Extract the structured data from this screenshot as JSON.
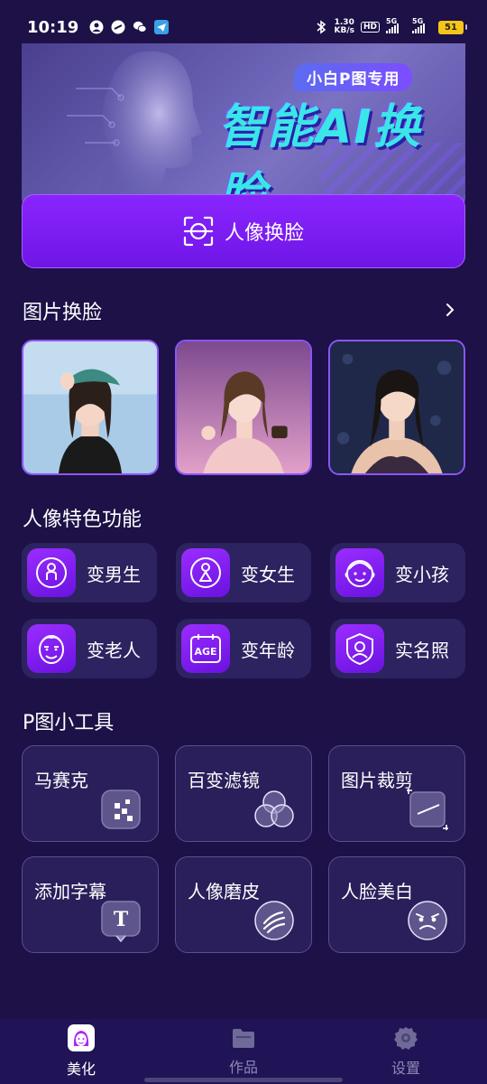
{
  "status_bar": {
    "time": "10:19",
    "net_speed_value": "1.30",
    "net_speed_unit": "KB/s",
    "hd": "HD",
    "sig1": "5G",
    "sig2": "5G",
    "battery": "51"
  },
  "banner": {
    "tag": "小白P图专用",
    "title": "智能AI换脸"
  },
  "face_swap_button": {
    "label": "人像换脸",
    "icon": "face-scan-icon"
  },
  "photo_section": {
    "title": "图片换脸"
  },
  "features_section": {
    "title": "人像特色功能",
    "items": [
      {
        "label": "变男生",
        "icon": "male-icon"
      },
      {
        "label": "变女生",
        "icon": "female-icon"
      },
      {
        "label": "变小孩",
        "icon": "child-face-icon"
      },
      {
        "label": "变老人",
        "icon": "elder-face-icon"
      },
      {
        "label": "变年龄",
        "icon": "age-icon"
      },
      {
        "label": "实名照",
        "icon": "id-photo-icon"
      }
    ],
    "age_icon_text": "AGE"
  },
  "tools_section": {
    "title": "P图小工具",
    "items": [
      {
        "label": "马赛克",
        "icon": "mosaic-icon"
      },
      {
        "label": "百变滤镜",
        "icon": "filter-icon"
      },
      {
        "label": "图片裁剪",
        "icon": "crop-icon"
      },
      {
        "label": "添加字幕",
        "icon": "text-icon"
      },
      {
        "label": "人像磨皮",
        "icon": "smooth-skin-icon"
      },
      {
        "label": "人脸美白",
        "icon": "whitening-icon"
      }
    ],
    "text_icon_glyph": "T"
  },
  "bottom_nav": {
    "items": [
      {
        "label": "美化",
        "active": true
      },
      {
        "label": "作品",
        "active": false
      },
      {
        "label": "设置",
        "active": false
      }
    ]
  },
  "colors": {
    "background": "#1d1147",
    "accent_purple": "#8a24ff",
    "card": "#2d2360",
    "banner_title": "#3ae6e8"
  }
}
